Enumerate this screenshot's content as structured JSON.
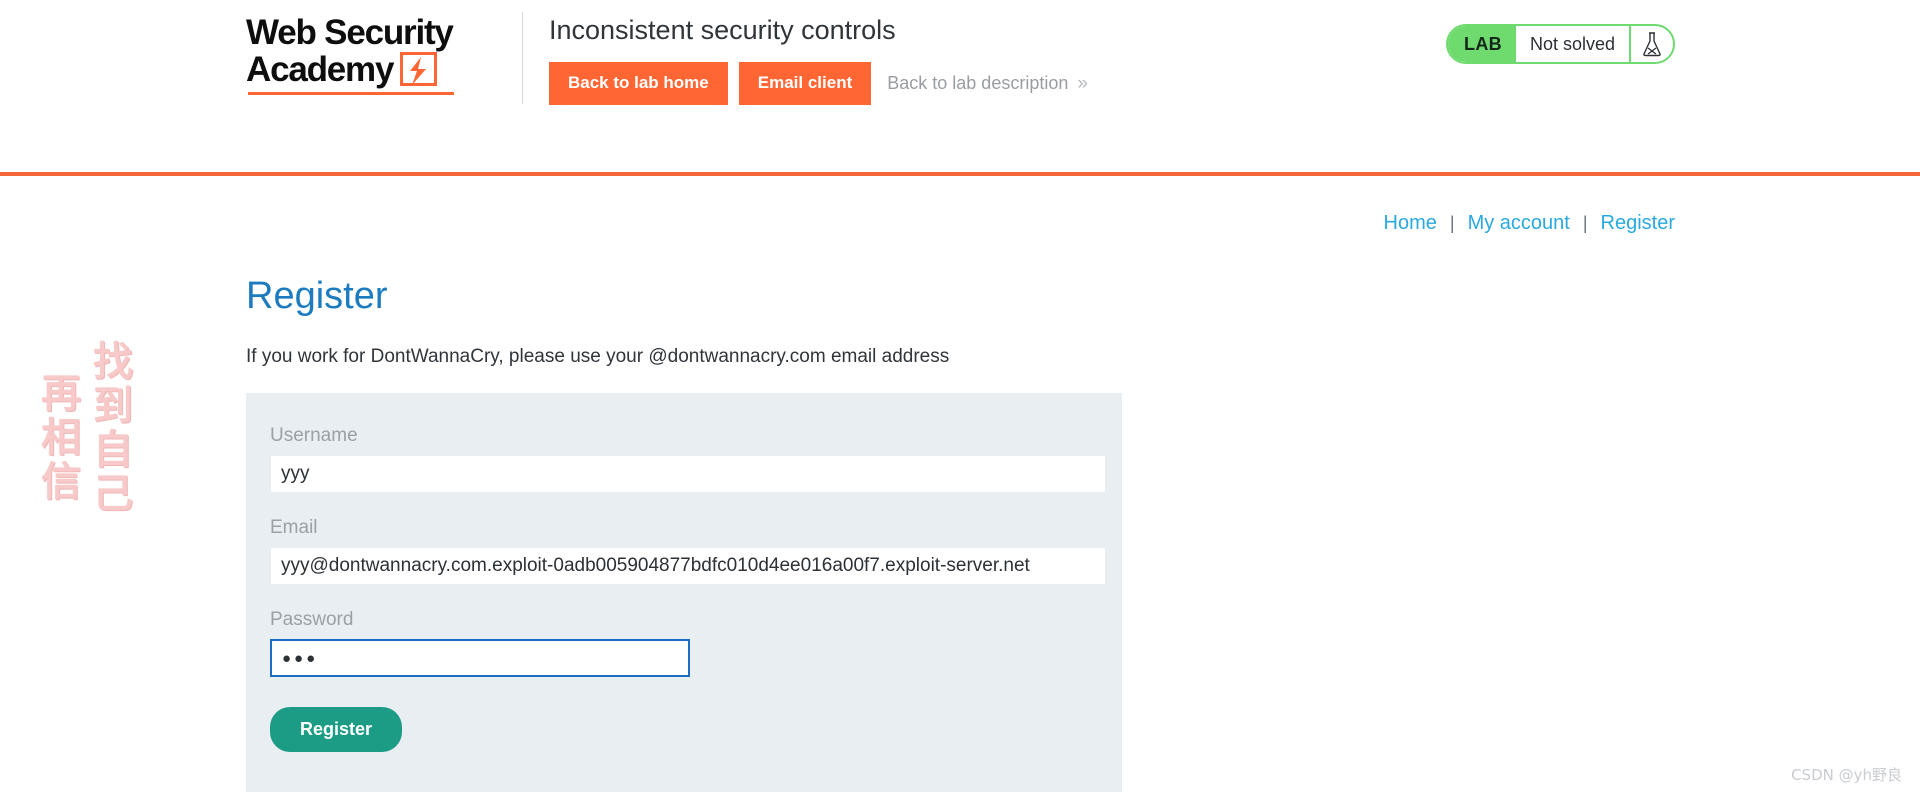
{
  "academy": {
    "logo_line1": "Web Security",
    "logo_line2": "Academy",
    "logo_mark_icon": "lightning-bolt-icon",
    "lab_title": "Inconsistent security controls",
    "back_to_lab_home": "Back to lab home",
    "email_client": "Email client",
    "back_to_lab_description": "Back to lab description",
    "chevron": "»",
    "status": {
      "tag": "LAB",
      "text": "Not solved",
      "icon": "flask-icon"
    }
  },
  "site_nav": {
    "separator": "|",
    "items": [
      {
        "label": "Home"
      },
      {
        "label": "My account"
      },
      {
        "label": "Register"
      }
    ]
  },
  "main": {
    "title": "Register",
    "intro": "If you work for DontWannaCry, please use your @dontwannacry.com email address",
    "form": {
      "username": {
        "label": "Username",
        "value": "yyy",
        "placeholder": ""
      },
      "email": {
        "label": "Email",
        "value": "yyy@dontwannacry.com.exploit-0adb005904877bdfc010d4ee016a00f7.exploit-server.net",
        "placeholder": ""
      },
      "password": {
        "label": "Password",
        "value": "●●●",
        "placeholder": ""
      },
      "submit_label": "Register"
    }
  },
  "watermarks": {
    "cn_right": "找到自己",
    "cn_left": "再相信",
    "csdn": "CSDN @yh野良"
  },
  "colors": {
    "accent_orange": "#ff6633",
    "rule_orange": "#f4653a",
    "link_blue": "#29a9e0",
    "title_blue": "#1d7bbf",
    "panel_grey": "#e8eef1",
    "button_teal": "#1c9c85",
    "status_green": "#6fdb6f",
    "focus_blue": "#1b6ec2"
  }
}
